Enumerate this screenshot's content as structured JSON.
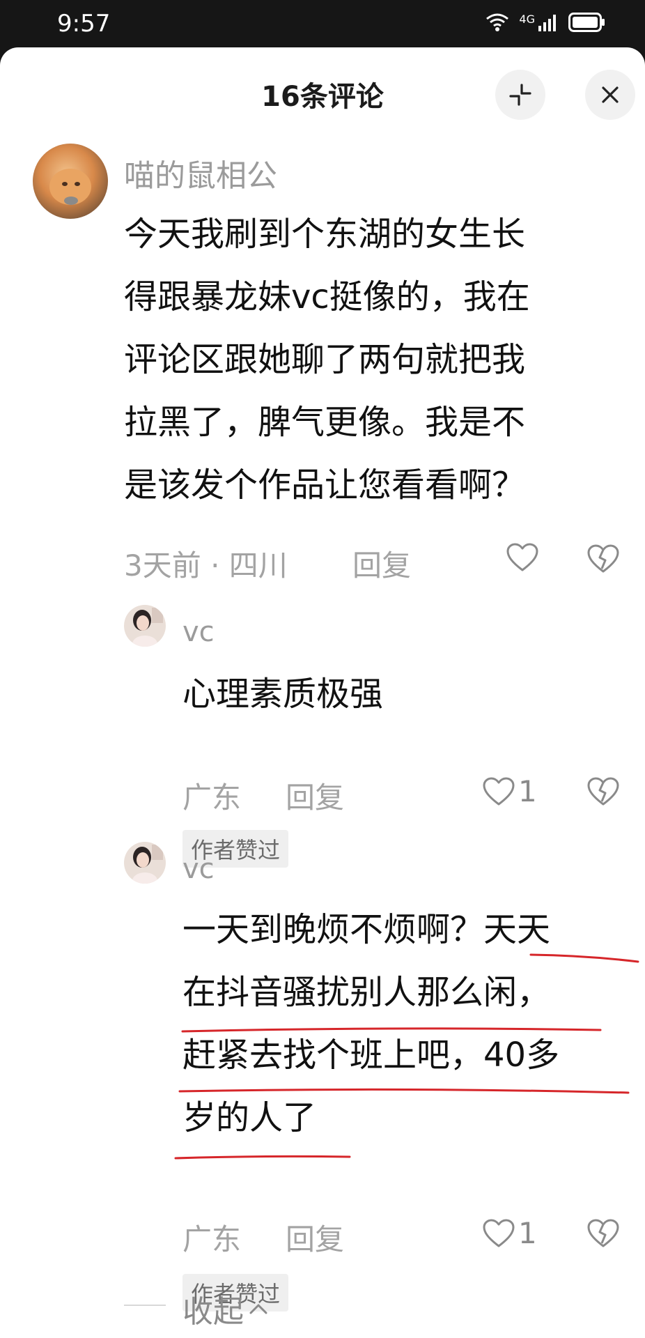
{
  "status_bar": {
    "time": "9:57",
    "network": "4G"
  },
  "header": {
    "title": "16条评论"
  },
  "comments": [
    {
      "user": "喵的鼠相公",
      "lines": [
        "今天我刷到个东湖的女生长",
        "得跟暴龙妹vc挺像的，我在",
        "评论区跟她聊了两句就把我",
        "拉黑了，脾气更像。我是不",
        "是该发个作品让您看看啊？"
      ],
      "time": "3天前",
      "location": "四川",
      "reply_label": "回复",
      "like_count": ""
    }
  ],
  "replies": [
    {
      "user": "vc",
      "lines": [
        "心理素质极强"
      ],
      "location": "广东",
      "reply_label": "回复",
      "like_count": "1",
      "badge": "作者赞过"
    },
    {
      "user": "vc",
      "lines": [
        "一天到晚烦不烦啊？天天",
        "在抖音骚扰别人那么闲，",
        "赶紧去找个班上吧，40多",
        "岁的人了"
      ],
      "location": "广东",
      "reply_label": "回复",
      "like_count": "1",
      "badge": "作者赞过"
    }
  ],
  "collapse_label": "收起",
  "colors": {
    "annotation_underline": "#d6262a",
    "sheet_bg": "#ffffff",
    "statusbar_bg": "#161616"
  }
}
